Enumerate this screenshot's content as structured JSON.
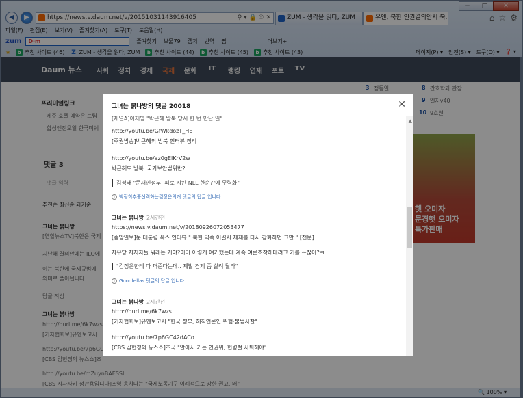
{
  "window": {
    "minimize": "─",
    "maximize": "□",
    "close": "✕"
  },
  "address": {
    "url": "https://news.v.daum.net/v/20151031143916405",
    "tools": "⚲ ▾ 🔒 ☉ ✕"
  },
  "tabs": [
    {
      "label": "ZUM - 생각을 읽다, ZUM",
      "close": "",
      "color": "#1e63c6"
    },
    {
      "label": "유엔, 북한 인권결의안서 북...",
      "close": "✕",
      "color": "#ff6a00"
    }
  ],
  "menu": [
    "파일(F)",
    "편집(E)",
    "보기(V)",
    "즐겨찾기(A)",
    "도구(T)",
    "도움말(H)"
  ],
  "zum_toolbar": {
    "logo": "zum",
    "search_value": "D·m",
    "items": [
      "즐겨찾기",
      "보물79",
      "캡처",
      "번역",
      "핌",
      "더보기+"
    ]
  },
  "favorites": [
    {
      "label": "추천 사이트 (46)",
      "icon": "b"
    },
    {
      "label": "ZUM - 생각을 읽다, ZUM",
      "icon": "Z"
    },
    {
      "label": "추천 사이트 (44)",
      "icon": "b"
    },
    {
      "label": "추천 사이트 (45)",
      "icon": "b"
    },
    {
      "label": "추천 사이트 (43)",
      "icon": "b"
    }
  ],
  "favorites_right": [
    "페이지(P) ▾",
    "안전(S) ▾",
    "도구(O) ▾",
    "❓ ▾"
  ],
  "daum_nav": {
    "logo": "Daum 뉴스",
    "items": [
      "사회",
      "정치",
      "경제",
      "국제",
      "문화",
      "IT",
      "랭킹",
      "연재",
      "포토",
      "TV"
    ],
    "active": "국제"
  },
  "background": {
    "premium_link": "프리미엄링크",
    "line1": "제주 호텔 예약은 트립",
    "line2": "합성엔진오일 한국미쉐",
    "comment_count": "댓글 3",
    "comment_input": "댓글 입력",
    "sort": "추천순   최신순   과거순",
    "author": "그녀는 붉나방",
    "b1": "[연합뉴스TV]북한은 국제",
    "b2": "지난해 결의안에는 ILO에",
    "b3": "이는 북한에 국제규범에",
    "b4": "의미로 풀이됩니다.",
    "b5": "답글 작성",
    "b6": "그녀는 붉나방",
    "b7": "http://durl.me/6k7wzs",
    "b8": "[기자협회보]유엔보고서",
    "b9": "http://youtu.be/7p6GC42",
    "b10": "[CBS 김현정의 뉴스쇼]조",
    "b11": "http://youtu.be/mZuynBAESSI",
    "b12": "[CBS 시사자키 정관용입니다]조영 옹치나는 \"국제노동기구 이례적으로 강한 권고, 왜\"",
    "right1_num": "3",
    "right1": "정동일",
    "right2_num": "8",
    "right2": "간호학과 관장...",
    "right3_num": "9",
    "right3": "엘지v40",
    "right4_num": "10",
    "right4": "9호선",
    "ad_line1": "햇 오미자",
    "ad_line2": "문경햇 오미자",
    "ad_line3": "특가판매"
  },
  "modal": {
    "title": "그녀는 붉나방의 댓글 20018",
    "close": "✕",
    "scroll_up": "▲",
    "top_cut": "[주간방송]박근혜의 방북 인터뷰 정리",
    "c0": {
      "l1": "[채널A]이재명 \"박근혜 방북 당시 한 번 만난 일\"",
      "l2": "http://youtu.be/GfWkdozT_HE",
      "l3": "[주권방송]박근혜의 방북 인터뷰 정리",
      "l4": "http://youtu.be/az0gElKrV2w",
      "l5": "박근혜도 방북..국가보안법위반?",
      "quote": "김성태 \"문재인정부, 피로 지킨 NLL 한순간에 무력화\"",
      "reply": "박정희추종신격화는김정은의개 댓글의 답글 입니다."
    },
    "c1": {
      "author": "그녀는 붉나방",
      "time": "2시간전",
      "more": "⋮",
      "l1": "https://news.v.daum.net/v/20180926072053477",
      "l2": "[중앙일보]문 대통령 폭스 인터뷰 \" 북한 약속 어길시 제재를 다시 강화하면 그만 \" [전문]",
      "l3": "자유당 지지자들 뭐래는 거야?이미 이렇게 얘기했는데 계속 여론조작해대려고 기를 쓰잖아?ㅋ",
      "quote": "\"김정은한테 다 퍼준다는데.. 제발 경제 좀 살려 달라\"",
      "reply": "Goodfellas 댓글의 답글 입니다."
    },
    "c2": {
      "author": "그녀는 붉나방",
      "time": "2시간전",
      "more": "⋮",
      "l1": "http://durl.me/6k7wzs",
      "l2": "[기자협회보]유엔보고서 \"한국 정부, 해직언론인 위험·불법사찰\"",
      "l3": "http://youtu.be/7p6GC42dACo",
      "l4": "[CBS 김현정의 뉴스쇼]조국 \"알아서 기는 인권위, 현병철 사퇴해야\""
    }
  },
  "status": {
    "zoom": "🔍 100%  ▾"
  }
}
